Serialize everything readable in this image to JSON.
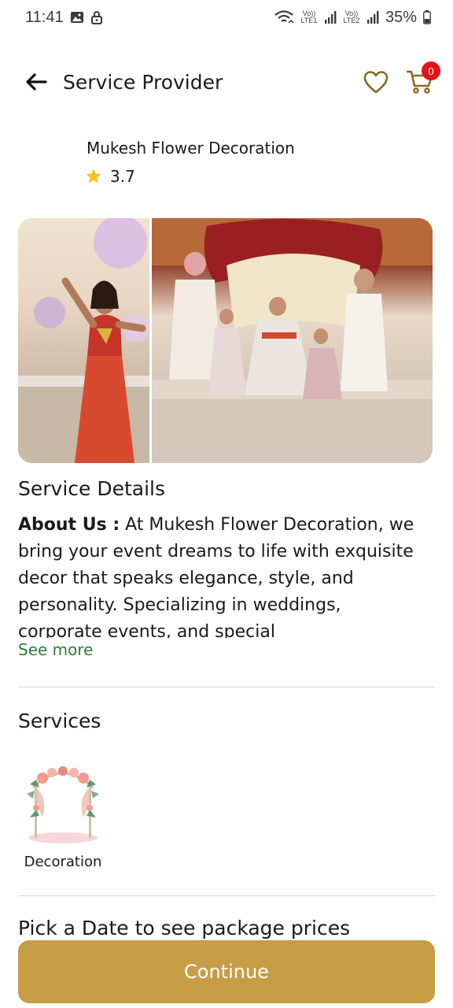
{
  "status_bar": {
    "time": "11:41",
    "lte1": "Vo)) LTE1",
    "lte2": "Vo)) LTE2",
    "battery": "35%"
  },
  "header": {
    "title": "Service Provider",
    "cart_count": "0"
  },
  "provider": {
    "name": "Mukesh Flower Decoration",
    "rating": "3.7"
  },
  "details": {
    "section_title": "Service Details",
    "about_label": "About Us :",
    "about_text": " At Mukesh Flower Decoration, we bring your event dreams to life with exquisite decor that speaks elegance, style, and personality. Specializing in weddings, corporate events, and special",
    "see_more": "See more"
  },
  "services": {
    "section_title": "Services",
    "items": [
      {
        "label": "Decoration"
      }
    ]
  },
  "date_section": {
    "title": "Pick a Date to see package prices"
  },
  "footer": {
    "continue_label": "Continue"
  },
  "colors": {
    "accent": "#c69d45",
    "heart_outline": "#8a6a22",
    "badge": "#e8101a",
    "link_green": "#2e7d32",
    "star": "#f5c518"
  }
}
